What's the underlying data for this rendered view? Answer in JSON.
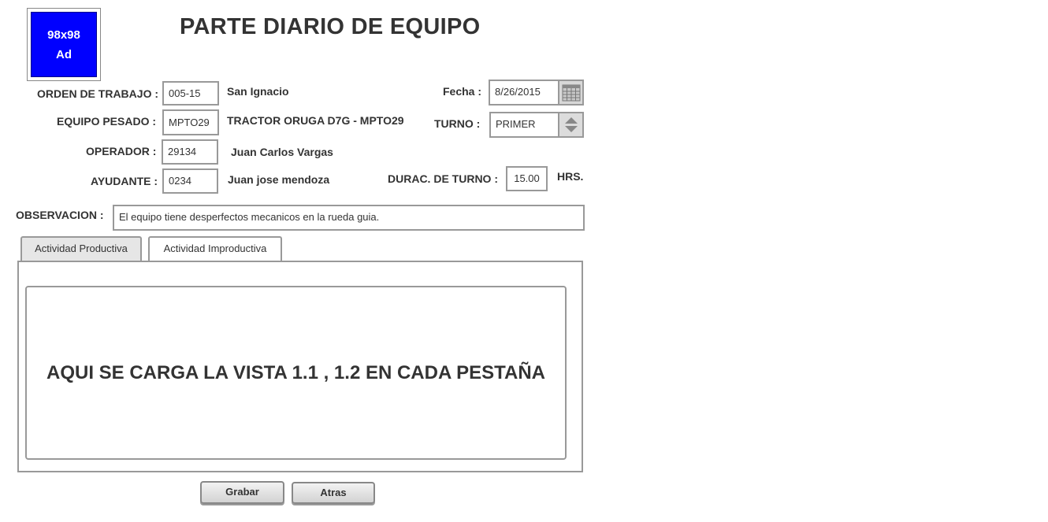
{
  "ad": {
    "line1": "98x98",
    "line2": "Ad"
  },
  "title": "PARTE DIARIO DE EQUIPO",
  "form": {
    "orden": {
      "label": "ORDEN DE TRABAJO :",
      "value": "005-15",
      "desc": "San Ignacio"
    },
    "equipo": {
      "label": "EQUIPO PESADO :",
      "value": "MPTO29",
      "desc": "TRACTOR ORUGA D7G - MPTO29"
    },
    "operador": {
      "label": "OPERADOR :",
      "value": "29134",
      "desc": "Juan Carlos Vargas"
    },
    "ayudante": {
      "label": "AYUDANTE :",
      "value": "0234",
      "desc": "Juan jose mendoza"
    },
    "fecha": {
      "label": "Fecha :",
      "value": "8/26/2015"
    },
    "turno": {
      "label": "TURNO :",
      "value": "PRIMER"
    },
    "duracion": {
      "label": "DURAC. DE TURNO :",
      "value": "15.00",
      "unit": "HRS."
    },
    "observacion": {
      "label": "OBSERVACION :",
      "value": "El equipo tiene desperfectos mecanicos en la rueda guia."
    }
  },
  "tabs": [
    {
      "label": "Actividad Productiva",
      "active": true
    },
    {
      "label": "Actividad Improductiva",
      "active": false
    }
  ],
  "content_placeholder": "AQUI SE CARGA LA VISTA 1.1 , 1.2 EN CADA PESTAÑA",
  "buttons": {
    "save": "Grabar",
    "back": "Atras"
  },
  "colors": {
    "ad_background": "#0000ff",
    "border": "#999999",
    "active_tab": "#e6e6e6"
  }
}
